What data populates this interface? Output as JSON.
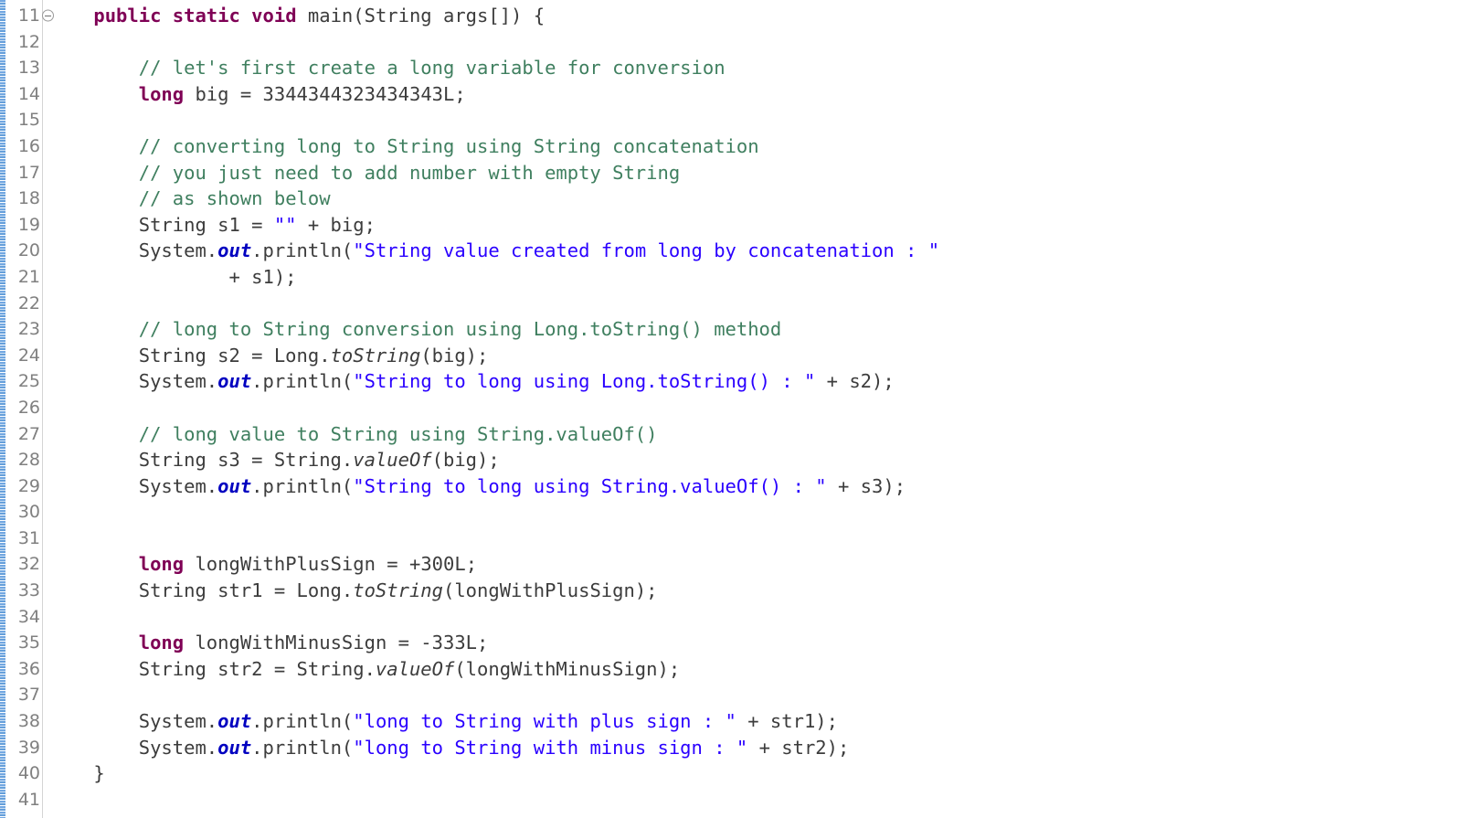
{
  "editor": {
    "language": "Java",
    "first_line_number": 11,
    "last_line_number": 41,
    "colors": {
      "background": "#ffffff",
      "keyword": "#7f0055",
      "comment": "#3f7f5f",
      "string": "#2a00ff",
      "static_field": "#0000c0",
      "plain_text": "#3c3c3c",
      "line_number": "#808080",
      "gutter_separator": "#d4d4d4",
      "annotation_ruler": "#5d9ad9"
    },
    "fold_marker_line": 11,
    "fold_marker_glyph": "⊖"
  },
  "lines": [
    {
      "number": "11",
      "fold": true,
      "tokens": [
        {
          "t": "plain",
          "s": "    "
        },
        {
          "t": "kw",
          "s": "public static void"
        },
        {
          "t": "plain",
          "s": " main(String args[]) {"
        }
      ]
    },
    {
      "number": "12",
      "fold": false,
      "tokens": []
    },
    {
      "number": "13",
      "fold": false,
      "tokens": [
        {
          "t": "plain",
          "s": "        "
        },
        {
          "t": "comment",
          "s": "// let's first create a long variable for conversion"
        }
      ]
    },
    {
      "number": "14",
      "fold": false,
      "tokens": [
        {
          "t": "plain",
          "s": "        "
        },
        {
          "t": "kw",
          "s": "long"
        },
        {
          "t": "plain",
          "s": " big = "
        },
        {
          "t": "number",
          "s": "3344344323434343L"
        },
        {
          "t": "plain",
          "s": ";"
        }
      ]
    },
    {
      "number": "15",
      "fold": false,
      "tokens": []
    },
    {
      "number": "16",
      "fold": false,
      "tokens": [
        {
          "t": "plain",
          "s": "        "
        },
        {
          "t": "comment",
          "s": "// converting long to String using String concatenation"
        }
      ]
    },
    {
      "number": "17",
      "fold": false,
      "tokens": [
        {
          "t": "plain",
          "s": "        "
        },
        {
          "t": "comment",
          "s": "// you just need to add number with empty String"
        }
      ]
    },
    {
      "number": "18",
      "fold": false,
      "tokens": [
        {
          "t": "plain",
          "s": "        "
        },
        {
          "t": "comment",
          "s": "// as shown below"
        }
      ]
    },
    {
      "number": "19",
      "fold": false,
      "tokens": [
        {
          "t": "plain",
          "s": "        String s1 = "
        },
        {
          "t": "string",
          "s": "\"\""
        },
        {
          "t": "plain",
          "s": " + big;"
        }
      ]
    },
    {
      "number": "20",
      "fold": false,
      "tokens": [
        {
          "t": "plain",
          "s": "        System."
        },
        {
          "t": "staticfld",
          "s": "out"
        },
        {
          "t": "plain",
          "s": ".println("
        },
        {
          "t": "string",
          "s": "\"String value created from long by concatenation : \""
        }
      ]
    },
    {
      "number": "21",
      "fold": false,
      "tokens": [
        {
          "t": "plain",
          "s": "                + s1);"
        }
      ]
    },
    {
      "number": "22",
      "fold": false,
      "tokens": []
    },
    {
      "number": "23",
      "fold": false,
      "tokens": [
        {
          "t": "plain",
          "s": "        "
        },
        {
          "t": "comment",
          "s": "// long to String conversion using Long.toString() method"
        }
      ]
    },
    {
      "number": "24",
      "fold": false,
      "tokens": [
        {
          "t": "plain",
          "s": "        String s2 = Long."
        },
        {
          "t": "staticmth",
          "s": "toString"
        },
        {
          "t": "plain",
          "s": "(big);"
        }
      ]
    },
    {
      "number": "25",
      "fold": false,
      "tokens": [
        {
          "t": "plain",
          "s": "        System."
        },
        {
          "t": "staticfld",
          "s": "out"
        },
        {
          "t": "plain",
          "s": ".println("
        },
        {
          "t": "string",
          "s": "\"String to long using Long.toString() : \""
        },
        {
          "t": "plain",
          "s": " + s2);"
        }
      ]
    },
    {
      "number": "26",
      "fold": false,
      "tokens": []
    },
    {
      "number": "27",
      "fold": false,
      "tokens": [
        {
          "t": "plain",
          "s": "        "
        },
        {
          "t": "comment",
          "s": "// long value to String using String.valueOf()"
        }
      ]
    },
    {
      "number": "28",
      "fold": false,
      "tokens": [
        {
          "t": "plain",
          "s": "        String s3 = String."
        },
        {
          "t": "staticmth",
          "s": "valueOf"
        },
        {
          "t": "plain",
          "s": "(big);"
        }
      ]
    },
    {
      "number": "29",
      "fold": false,
      "tokens": [
        {
          "t": "plain",
          "s": "        System."
        },
        {
          "t": "staticfld",
          "s": "out"
        },
        {
          "t": "plain",
          "s": ".println("
        },
        {
          "t": "string",
          "s": "\"String to long using String.valueOf() : \""
        },
        {
          "t": "plain",
          "s": " + s3);"
        }
      ]
    },
    {
      "number": "30",
      "fold": false,
      "tokens": []
    },
    {
      "number": "31",
      "fold": false,
      "tokens": []
    },
    {
      "number": "32",
      "fold": false,
      "tokens": [
        {
          "t": "plain",
          "s": "        "
        },
        {
          "t": "kw",
          "s": "long"
        },
        {
          "t": "plain",
          "s": " longWithPlusSign = +"
        },
        {
          "t": "number",
          "s": "300L"
        },
        {
          "t": "plain",
          "s": ";"
        }
      ]
    },
    {
      "number": "33",
      "fold": false,
      "tokens": [
        {
          "t": "plain",
          "s": "        String str1 = Long."
        },
        {
          "t": "staticmth",
          "s": "toString"
        },
        {
          "t": "plain",
          "s": "(longWithPlusSign);"
        }
      ]
    },
    {
      "number": "34",
      "fold": false,
      "tokens": []
    },
    {
      "number": "35",
      "fold": false,
      "tokens": [
        {
          "t": "plain",
          "s": "        "
        },
        {
          "t": "kw",
          "s": "long"
        },
        {
          "t": "plain",
          "s": " longWithMinusSign = -"
        },
        {
          "t": "number",
          "s": "333L"
        },
        {
          "t": "plain",
          "s": ";"
        }
      ]
    },
    {
      "number": "36",
      "fold": false,
      "tokens": [
        {
          "t": "plain",
          "s": "        String str2 = String."
        },
        {
          "t": "staticmth",
          "s": "valueOf"
        },
        {
          "t": "plain",
          "s": "(longWithMinusSign);"
        }
      ]
    },
    {
      "number": "37",
      "fold": false,
      "tokens": []
    },
    {
      "number": "38",
      "fold": false,
      "tokens": [
        {
          "t": "plain",
          "s": "        System."
        },
        {
          "t": "staticfld",
          "s": "out"
        },
        {
          "t": "plain",
          "s": ".println("
        },
        {
          "t": "string",
          "s": "\"long to String with plus sign : \""
        },
        {
          "t": "plain",
          "s": " + str1);"
        }
      ]
    },
    {
      "number": "39",
      "fold": false,
      "tokens": [
        {
          "t": "plain",
          "s": "        System."
        },
        {
          "t": "staticfld",
          "s": "out"
        },
        {
          "t": "plain",
          "s": ".println("
        },
        {
          "t": "string",
          "s": "\"long to String with minus sign : \""
        },
        {
          "t": "plain",
          "s": " + str2);"
        }
      ]
    },
    {
      "number": "40",
      "fold": false,
      "tokens": [
        {
          "t": "plain",
          "s": "    }"
        }
      ]
    },
    {
      "number": "41",
      "fold": false,
      "tokens": []
    }
  ]
}
